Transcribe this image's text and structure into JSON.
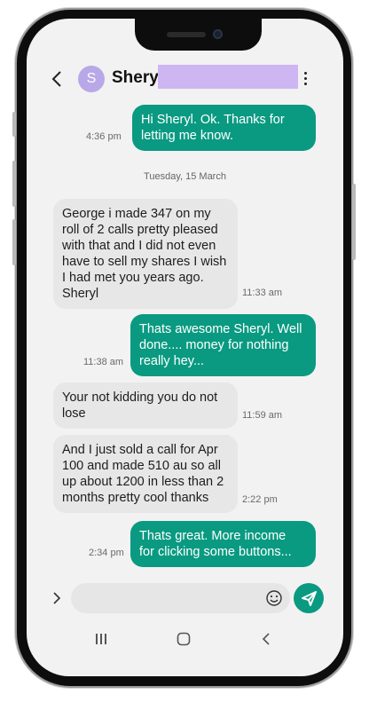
{
  "contact": {
    "name": "Sheryl",
    "avatar_letter": "S",
    "avatar_color": "#b9a8e8"
  },
  "icons": {
    "back": "chevron-left-icon",
    "more": "more-vertical-icon",
    "expand": "chevron-right-icon",
    "emoji": "smiley-icon",
    "send": "send-icon",
    "nav_recents": "recents-icon",
    "nav_home": "home-icon",
    "nav_back": "nav-back-icon"
  },
  "colors": {
    "outgoing_bubble": "#0a9a81",
    "incoming_bubble": "#e7e7e7",
    "redaction": "#cdb6f2"
  },
  "messages": [
    {
      "direction": "out",
      "text": "Hi Sheryl. Ok. Thanks for\nletting me know.",
      "time": "4:36 pm"
    },
    {
      "direction": "separator",
      "text": "Tuesday, 15 March"
    },
    {
      "direction": "in",
      "text": "George i made 347 on my\nroll of 2 calls  pretty pleased\nwith that and I did not even\nhave to sell my shares I wish\nI had met you years ago.\nSheryl",
      "time": "11:33 am"
    },
    {
      "direction": "out",
      "text": "Thats awesome Sheryl. Well\ndone.... money for nothing\nreally hey...",
      "time": "11:38 am"
    },
    {
      "direction": "in",
      "text": "Your not kidding you do not\nlose",
      "time": "11:59 am"
    },
    {
      "direction": "in",
      "text": "And I just sold a call for Apr\n100 and made 510 au so all\nup about 1200 in less than 2\nmonths pretty cool thanks",
      "time": "2:22 pm"
    },
    {
      "direction": "out",
      "text": "Thats great. More income\nfor clicking some buttons...",
      "time": "2:34 pm"
    }
  ],
  "composer": {
    "value": "",
    "placeholder": ""
  }
}
